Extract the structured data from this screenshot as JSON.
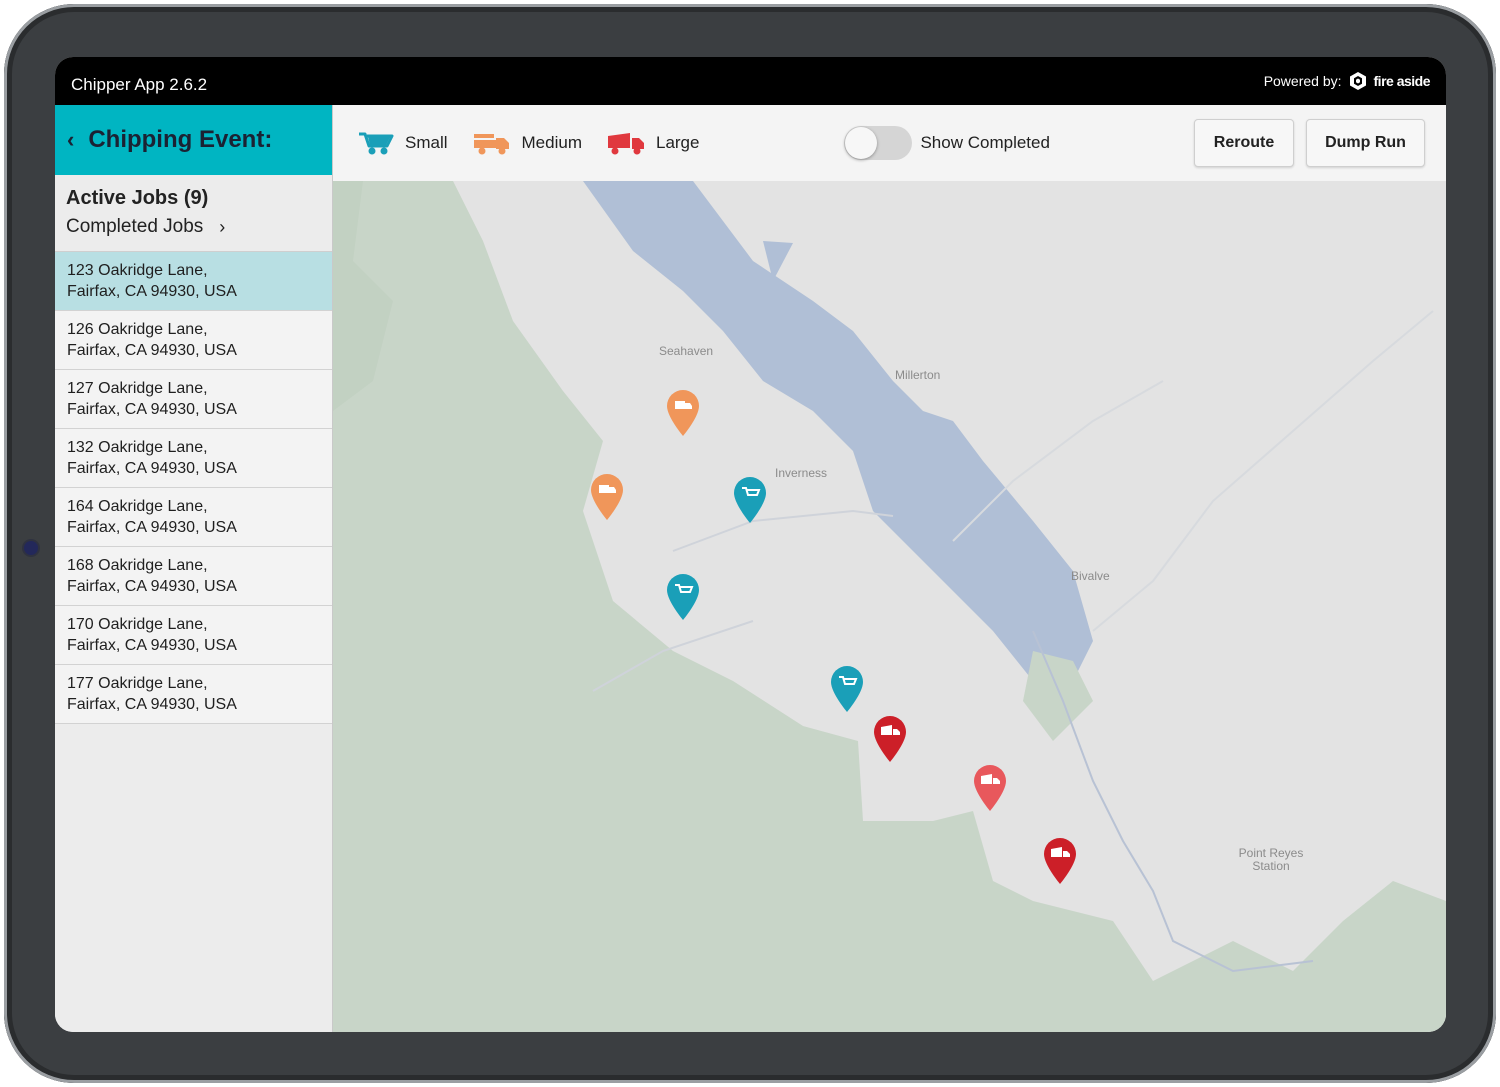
{
  "status_bar": {
    "app_title": "Chipper App 2.6.2",
    "powered_by": "Powered by:",
    "brand": "fire aside"
  },
  "sidebar": {
    "event_title": "Chipping Event:",
    "active_jobs": "Active Jobs (9)",
    "completed_jobs": "Completed Jobs",
    "jobs": [
      {
        "line1": "123 Oakridge Lane,",
        "line2": "Fairfax, CA 94930, USA",
        "selected": true
      },
      {
        "line1": "126 Oakridge Lane,",
        "line2": "Fairfax, CA 94930, USA"
      },
      {
        "line1": "127 Oakridge Lane,",
        "line2": "Fairfax, CA 94930, USA"
      },
      {
        "line1": "132 Oakridge Lane,",
        "line2": "Fairfax, CA 94930, USA"
      },
      {
        "line1": "164 Oakridge Lane,",
        "line2": "Fairfax, CA 94930, USA"
      },
      {
        "line1": "168 Oakridge Lane,",
        "line2": "Fairfax, CA 94930, USA"
      },
      {
        "line1": "170 Oakridge Lane,",
        "line2": "Fairfax, CA 94930, USA"
      },
      {
        "line1": "177 Oakridge Lane,",
        "line2": "Fairfax, CA 94930, USA"
      }
    ]
  },
  "toolbar": {
    "legend": [
      {
        "label": "Small",
        "icon": "wheelbarrow-icon",
        "color": "#1a9fb8"
      },
      {
        "label": "Medium",
        "icon": "pickup-truck-icon",
        "color": "#f0965a"
      },
      {
        "label": "Large",
        "icon": "dump-truck-icon",
        "color": "#e0383e"
      }
    ],
    "show_completed_label": "Show Completed",
    "show_completed_on": false,
    "reroute_label": "Reroute",
    "dump_run_label": "Dump Run"
  },
  "map": {
    "places": [
      "Seahaven",
      "Millerton",
      "Inverness",
      "Bivalve",
      "Point Reyes Station"
    ],
    "pins": [
      {
        "size": "Medium",
        "color": "#f0965a"
      },
      {
        "size": "Medium",
        "color": "#f0965a"
      },
      {
        "size": "Small",
        "color": "#1a9fb8"
      },
      {
        "size": "Small",
        "color": "#1a9fb8"
      },
      {
        "size": "Small",
        "color": "#1a9fb8"
      },
      {
        "size": "Large",
        "color": "#cc1f28"
      },
      {
        "size": "Large",
        "color": "#e8585c"
      },
      {
        "size": "Large",
        "color": "#cc1f28"
      }
    ]
  }
}
